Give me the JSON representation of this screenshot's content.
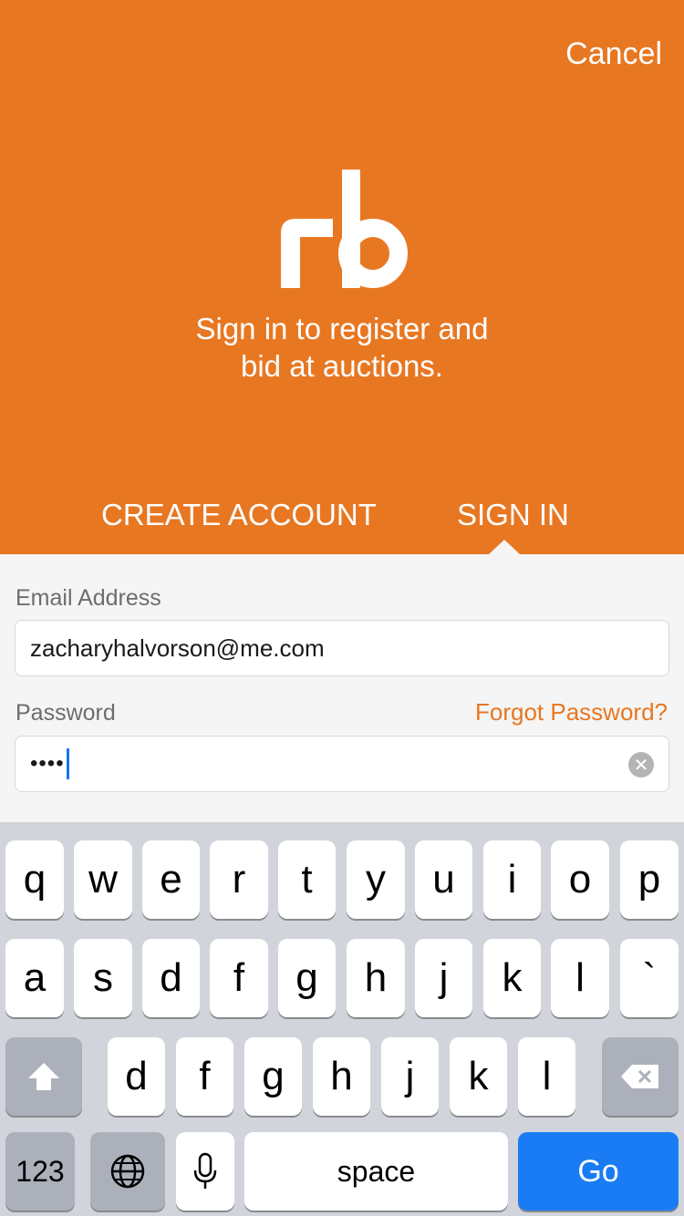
{
  "header": {
    "cancel_label": "Cancel",
    "logo_text": "rb",
    "tagline_line1": "Sign in to register and",
    "tagline_line2": "bid at auctions.",
    "tabs": [
      {
        "label": "CREATE ACCOUNT",
        "selected": false
      },
      {
        "label": "SIGN IN",
        "selected": true
      }
    ]
  },
  "form": {
    "email_label": "Email Address",
    "email_value": "zacharyhalvorson@me.com",
    "password_label": "Password",
    "forgot_label": "Forgot Password?",
    "password_value": "••••"
  },
  "keyboard": {
    "row1": [
      "q",
      "w",
      "e",
      "r",
      "t",
      "y",
      "u",
      "i",
      "o",
      "p"
    ],
    "row2": [
      "a",
      "s",
      "d",
      "f",
      "g",
      "h",
      "j",
      "k",
      "l",
      "`"
    ],
    "row3": [
      "d",
      "f",
      "g",
      "h",
      "j",
      "k",
      "l"
    ],
    "numbers_label": "123",
    "space_label": "space",
    "go_label": "Go"
  },
  "colors": {
    "accent": "#e87722",
    "go_key": "#1a7cf4",
    "keyboard_bg": "#d1d5db"
  }
}
